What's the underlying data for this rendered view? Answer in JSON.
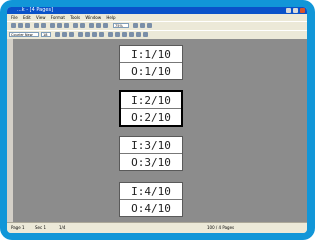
{
  "window": {
    "title": "...k - [4 Pages]"
  },
  "menu": [
    "File",
    "Edit",
    "View",
    "Format",
    "Tools",
    "Window",
    "Help"
  ],
  "toolbar": {
    "zoom_value": "75%",
    "font_name": "Courier New",
    "font_size": "18"
  },
  "pages": [
    {
      "input": "I:1/10",
      "output": "O:1/10",
      "selected": false
    },
    {
      "input": "I:2/10",
      "output": "O:2/10",
      "selected": true
    },
    {
      "input": "I:3/10",
      "output": "O:3/10",
      "selected": false
    },
    {
      "input": "I:4/10",
      "output": "O:4/10",
      "selected": false
    }
  ],
  "status": {
    "page": "Page 1",
    "section": "Sec 1",
    "pos": "1/4",
    "right": "100 / 4 Pages"
  }
}
